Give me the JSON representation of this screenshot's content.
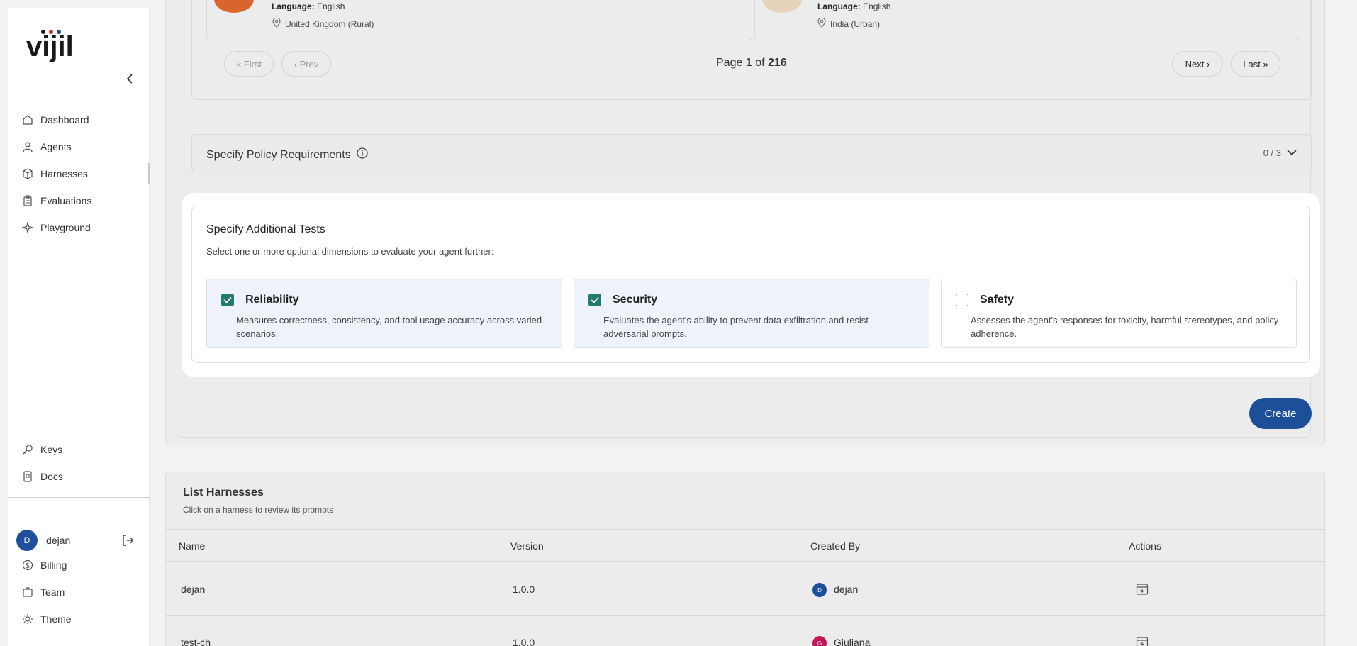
{
  "brand": {
    "logo_text": "vijil"
  },
  "sidebar": {
    "nav": [
      {
        "label": "Dashboard",
        "icon": "home-icon"
      },
      {
        "label": "Agents",
        "icon": "user-icon"
      },
      {
        "label": "Harnesses",
        "icon": "package-icon"
      },
      {
        "label": "Evaluations",
        "icon": "clipboard-icon"
      },
      {
        "label": "Playground",
        "icon": "sparkle-icon"
      }
    ],
    "bottom_nav": [
      {
        "label": "Keys",
        "icon": "key-icon"
      },
      {
        "label": "Docs",
        "icon": "docs-icon"
      }
    ],
    "user": {
      "initial": "D",
      "name": "dejan"
    },
    "footer_nav": [
      {
        "label": "Billing",
        "icon": "dollar-icon"
      },
      {
        "label": "Team",
        "icon": "team-icon"
      },
      {
        "label": "Theme",
        "icon": "sun-icon"
      }
    ]
  },
  "personas": [
    {
      "language_label": "Language:",
      "language": "English",
      "location": "United Kingdom (Rural)"
    },
    {
      "language_label": "Language:",
      "language": "English",
      "location": "India (Urban)"
    }
  ],
  "pagination": {
    "first": "« First",
    "prev": "‹ Prev",
    "next": "Next ›",
    "last": "Last »",
    "page_word": "Page",
    "current": "1",
    "of_word": "of",
    "total": "216"
  },
  "policy": {
    "title": "Specify Policy Requirements",
    "count": "0 / 3"
  },
  "additional_tests": {
    "title": "Specify Additional Tests",
    "subtitle": "Select one or more optional dimensions to evaluate your agent further:",
    "options": [
      {
        "title": "Reliability",
        "desc": "Measures correctness, consistency, and tool usage accuracy across varied scenarios.",
        "checked": true
      },
      {
        "title": "Security",
        "desc": "Evaluates the agent's ability to prevent data exfiltration and resist adversarial prompts.",
        "checked": true
      },
      {
        "title": "Safety",
        "desc": "Assesses the agent's responses for toxicity, harmful stereotypes, and policy adherence.",
        "checked": false
      }
    ]
  },
  "create_label": "Create",
  "list": {
    "title": "List Harnesses",
    "subtitle": "Click on a harness to review its prompts",
    "columns": [
      "Name",
      "Version",
      "Created By",
      "Actions"
    ],
    "rows": [
      {
        "name": "dejan",
        "version": "1.0.0",
        "creator_initial": "D",
        "creator": "dejan",
        "avatar_color": "#1e4f9c"
      },
      {
        "name": "test-ch",
        "version": "1.0.0",
        "creator_initial": "G",
        "creator": "Giuliana",
        "avatar_color": "#c2185b"
      }
    ]
  }
}
